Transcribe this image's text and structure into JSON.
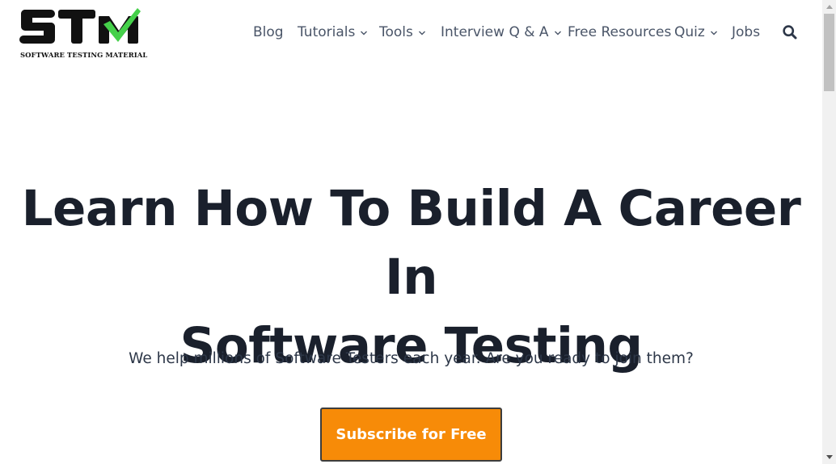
{
  "brand": {
    "logo_text": "STM",
    "tagline": "SOFTWARE TESTING MATERIAL",
    "logo_color": "#111111",
    "check_color": "#45d04a"
  },
  "nav": {
    "items": [
      {
        "label": "Blog",
        "has_dropdown": false
      },
      {
        "label": "Tutorials",
        "has_dropdown": true
      },
      {
        "label": "Tools",
        "has_dropdown": true
      },
      {
        "label": "Interview Q & A",
        "has_dropdown": true
      },
      {
        "label": "Free Resources",
        "has_dropdown": false
      },
      {
        "label": "Quiz",
        "has_dropdown": true
      },
      {
        "label": "Jobs",
        "has_dropdown": false
      }
    ],
    "search_icon": "search-icon"
  },
  "hero": {
    "title_line1": "Learn How To Build A Career In",
    "title_line2": "Software Testing",
    "subtitle": "We help millions of Software Testers each year. Are you ready to join them?",
    "cta_label": "Subscribe for Free"
  },
  "colors": {
    "text_dark": "#1a202c",
    "nav_text": "#4a5568",
    "cta_bg": "#f78b08",
    "cta_border": "#3d3d3d"
  }
}
